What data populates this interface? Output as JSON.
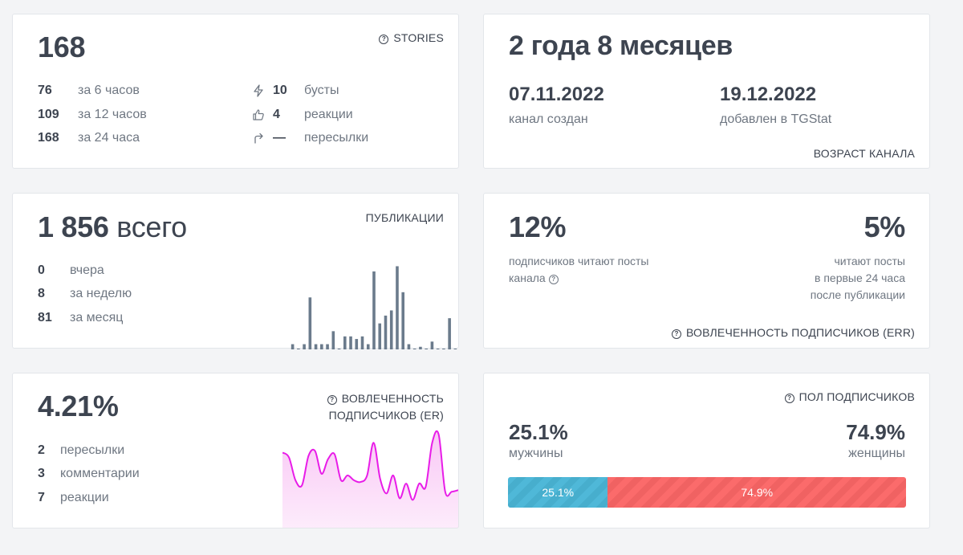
{
  "stories": {
    "total": "168",
    "caption": "STORIES",
    "rows": [
      {
        "value": "76",
        "label": "за 6 часов"
      },
      {
        "value": "109",
        "label": "за 12 часов"
      },
      {
        "value": "168",
        "label": "за 24 часа"
      }
    ],
    "stats": [
      {
        "icon": "bolt-icon",
        "value": "10",
        "label": "бусты"
      },
      {
        "icon": "thumbs-up-icon",
        "value": "4",
        "label": "реакции"
      },
      {
        "icon": "share-arrow-icon",
        "value": "—",
        "label": "пересылки"
      }
    ]
  },
  "age": {
    "title": "2 года 8 месяцев",
    "created_date": "07.11.2022",
    "created_label": "канал создан",
    "added_date": "19.12.2022",
    "added_label": "добавлен в TGStat",
    "caption": "ВОЗРАСТ КАНАЛА"
  },
  "publications": {
    "total": "1 856",
    "total_suffix": "всего",
    "caption": "ПУБЛИКАЦИИ",
    "rows": [
      {
        "value": "0",
        "label": "вчера"
      },
      {
        "value": "8",
        "label": "за неделю"
      },
      {
        "value": "81",
        "label": "за месяц"
      }
    ],
    "chart_color": "#6b7b8c"
  },
  "err": {
    "left_value": "12%",
    "left_text_1": "подписчиков читают посты",
    "left_text_2": "канала",
    "right_value": "5%",
    "right_text_1": "читают посты",
    "right_text_2": "в первые 24 часа",
    "right_text_3": "после публикации",
    "caption": "ВОВЛЕЧЕННОСТЬ ПОДПИСЧИКОВ (ERR)"
  },
  "er": {
    "value": "4.21%",
    "caption_1": "ВОВЛЕЧЕННОСТЬ",
    "caption_2": "ПОДПИСЧИКОВ (ER)",
    "rows": [
      {
        "value": "2",
        "label": "пересылки"
      },
      {
        "value": "3",
        "label": "комментарии"
      },
      {
        "value": "7",
        "label": "реакции"
      }
    ],
    "line_color": "#e81ce8",
    "fill_color": "#f9c8f5"
  },
  "gender": {
    "caption": "ПОЛ ПОДПИСЧИКОВ",
    "male_value": "25.1%",
    "male_label": "мужчины",
    "female_value": "74.9%",
    "female_label": "женщины",
    "male_share": 25.1,
    "female_share": 74.9,
    "male_color": "#4fb8d8",
    "female_color": "#fb6b6b"
  },
  "chart_data": [
    {
      "type": "bar",
      "values": [
        2,
        0,
        2,
        20,
        2,
        2,
        2,
        7,
        0,
        5,
        5,
        4,
        5,
        2,
        30,
        10,
        13,
        15,
        32,
        22,
        2,
        0,
        1,
        0,
        3,
        0,
        0,
        12,
        0
      ],
      "ylim": [
        0,
        34
      ]
    },
    {
      "type": "area",
      "values": [
        4.6,
        4.3,
        2.9,
        2.6,
        4.4,
        4.7,
        3.3,
        4.2,
        4.5,
        2.9,
        3.2,
        2.9,
        2.8,
        3.2,
        5.2,
        3.0,
        2.1,
        3.2,
        1.8,
        2.7,
        1.7,
        2.7,
        2.5,
        5.2,
        5.7,
        2.2,
        2.2,
        2.3
      ]
    }
  ]
}
